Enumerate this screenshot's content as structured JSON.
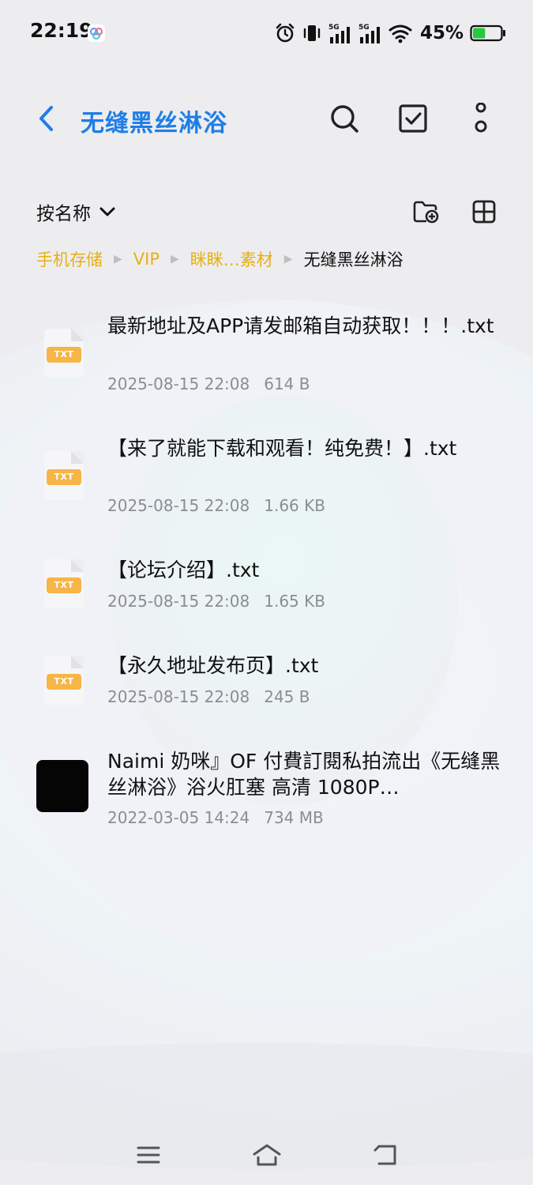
{
  "status_bar": {
    "time": "22:19",
    "network_1": "5G",
    "network_2": "5G",
    "battery_percent": "45%",
    "battery_level": 0.45
  },
  "header": {
    "back_icon": "chevron-left-icon",
    "title": "无缝黑丝淋浴",
    "actions": [
      "search-icon",
      "checkbox-icon",
      "more-vertical-icon"
    ],
    "accent_color": "#1e7ee6"
  },
  "toolbar": {
    "sort_label": "按名称",
    "actions": [
      "new-folder-icon",
      "grid-view-icon"
    ]
  },
  "breadcrumb": {
    "items": [
      "手机存储",
      "VIP",
      "眯眯…素材"
    ],
    "current": "无缝黑丝淋浴",
    "color": "#e7b012"
  },
  "files": [
    {
      "type_label": "TXT",
      "name": "最新地址及APP请发邮箱自动获取！！！.txt",
      "date": "2025-08-15 22:08",
      "size": "614 B"
    },
    {
      "type_label": "TXT",
      "name": "【来了就能下载和观看！纯免费！】.txt",
      "date": "2025-08-15 22:08",
      "size": "1.66 KB"
    },
    {
      "type_label": "TXT",
      "name": "【论坛介绍】.txt",
      "date": "2025-08-15 22:08",
      "size": "1.65 KB"
    },
    {
      "type_label": "TXT",
      "name": "【永久地址发布页】.txt",
      "date": "2025-08-15 22:08",
      "size": "245 B"
    },
    {
      "type_label": "",
      "name": "Naimi 奶咪』OF 付費訂閱私拍流出《无缝黑丝淋浴》浴火肛塞 高清 1080P…",
      "date": "2022-03-05 14:24",
      "size": "734 MB"
    }
  ],
  "nav_bar": [
    "menu-icon",
    "home-icon",
    "back-icon"
  ]
}
